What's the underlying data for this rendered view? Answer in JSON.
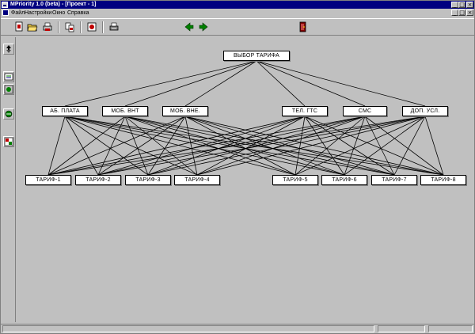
{
  "window": {
    "title": "MPriority 1.0 (beta) - [Проект - 1]",
    "controls": {
      "minimize": "_",
      "maximize": "□",
      "close": "×"
    }
  },
  "menu": {
    "items": [
      "Файл",
      "Настройки",
      "Окно",
      "Справка"
    ]
  },
  "toolbar": {
    "icons": [
      "new-icon",
      "open-icon",
      "print-icon",
      "copy-icon",
      "disk-icon",
      "printer-icon",
      "back-arrow-icon",
      "forward-arrow-icon",
      "exit-door-icon"
    ],
    "accent": "#008000"
  },
  "sidebar": {
    "tools": [
      "select-tool-icon",
      "add-node-icon",
      "add-level-icon",
      "connect-icon",
      "table-icon"
    ]
  },
  "hierarchy": {
    "goal": "ВЫБОР ТАРИФА",
    "criteria": [
      "АБ. ПЛАТА",
      "МОБ. ВНТ",
      "МОБ. ВНЕ.",
      "ТЕЛ. ГТС",
      "СМС",
      "ДОП. УСЛ."
    ],
    "alternatives": [
      "ТАРИФ-1",
      "ТАРИФ-2",
      "ТАРИФ-3",
      "ТАРИФ-4",
      "ТАРИФ-5",
      "ТАРИФ-6",
      "ТАРИФ-7",
      "ТАРИФ-8"
    ]
  },
  "colors": {
    "titlebar": "#000080",
    "face": "#c0c0c0",
    "node": "#ffffff"
  }
}
